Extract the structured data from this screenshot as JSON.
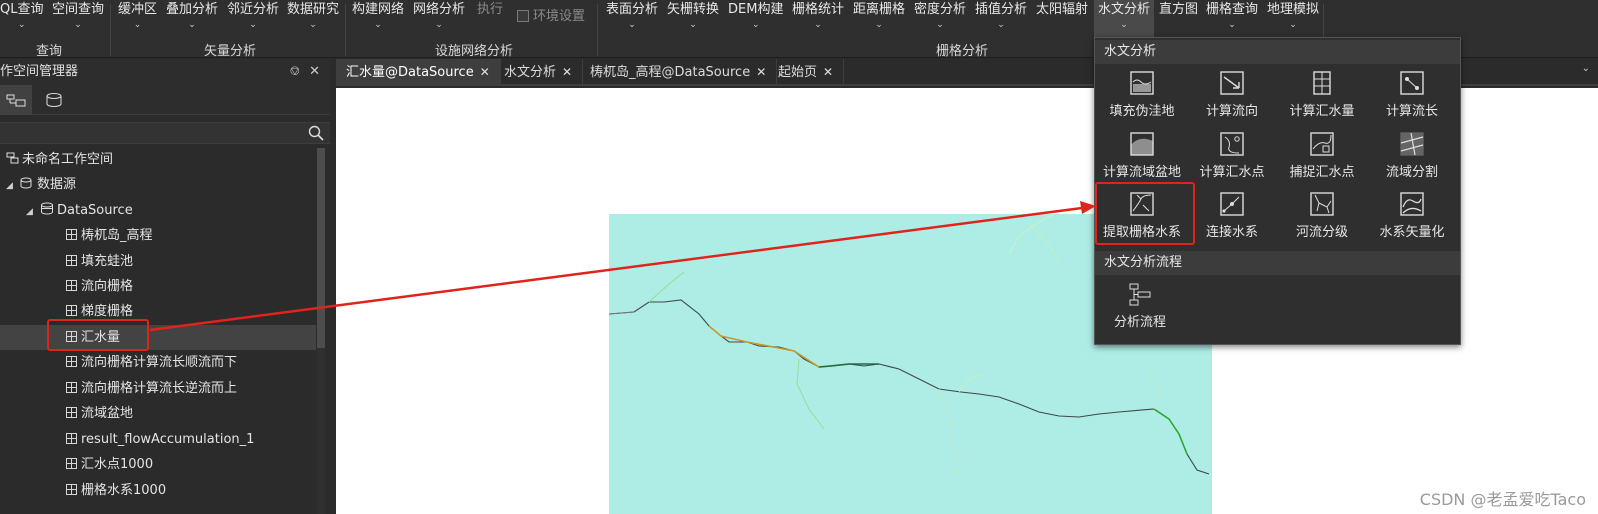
{
  "ribbon": {
    "items": [
      {
        "label": "QL查询",
        "chevron": true
      },
      {
        "label": "空间查询",
        "chevron": true
      },
      {
        "label": "缓冲区",
        "chevron": true
      },
      {
        "label": "叠加分析",
        "chevron": true
      },
      {
        "label": "邻近分析",
        "chevron": true
      },
      {
        "label": "数据研究",
        "chevron": true
      },
      {
        "label": "构建网络",
        "chevron": true
      },
      {
        "label": "网络分析",
        "chevron": true
      },
      {
        "label": "执行",
        "chevron": false
      },
      {
        "label": "环境设置",
        "chevron": false
      },
      {
        "label": "表面分析",
        "chevron": true
      },
      {
        "label": "矢栅转换",
        "chevron": true
      },
      {
        "label": "DEM构建",
        "chevron": true
      },
      {
        "label": "栅格统计",
        "chevron": true
      },
      {
        "label": "距离栅格",
        "chevron": true
      },
      {
        "label": "密度分析",
        "chevron": true
      },
      {
        "label": "插值分析",
        "chevron": true
      },
      {
        "label": "太阳辐射",
        "chevron": false
      },
      {
        "label": "水文分析",
        "chevron": true
      },
      {
        "label": "直方图",
        "chevron": false
      },
      {
        "label": "栅格查询",
        "chevron": true
      },
      {
        "label": "地理模拟",
        "chevron": true
      }
    ],
    "groups": [
      "查询",
      "矢量分析",
      "设施网络分析",
      "栅格分析"
    ]
  },
  "left_panel": {
    "title": "作空间管理器",
    "pin_icon": "pin-icon",
    "close_icon": "close-icon",
    "tree": [
      {
        "label": "未命名工作空间",
        "level": 0,
        "expander": "",
        "icon": "workspace-icon"
      },
      {
        "label": "数据源",
        "level": 0,
        "expander": "◢",
        "icon": "datasources-icon"
      },
      {
        "label": "DataSource",
        "level": 1,
        "expander": "◢",
        "icon": "database-icon"
      },
      {
        "label": "梼杌岛_高程",
        "level": 2,
        "expander": "",
        "icon": "grid-icon"
      },
      {
        "label": "填充蛙池",
        "level": 2,
        "expander": "",
        "icon": "grid-icon"
      },
      {
        "label": "流向栅格",
        "level": 2,
        "expander": "",
        "icon": "grid-icon"
      },
      {
        "label": "梯度栅格",
        "level": 2,
        "expander": "",
        "icon": "grid-icon"
      },
      {
        "label": "汇水量",
        "level": 2,
        "expander": "",
        "icon": "grid-icon",
        "selected": true
      },
      {
        "label": "流向栅格计算流长顺流而下",
        "level": 2,
        "expander": "",
        "icon": "grid-icon"
      },
      {
        "label": "流向栅格计算流长逆流而上",
        "level": 2,
        "expander": "",
        "icon": "grid-icon"
      },
      {
        "label": "流域盆地",
        "level": 2,
        "expander": "",
        "icon": "grid-icon"
      },
      {
        "label": "result_flowAccumulation_1",
        "level": 2,
        "expander": "",
        "icon": "grid-icon"
      },
      {
        "label": "汇水点1000",
        "level": 2,
        "expander": "",
        "icon": "grid-icon"
      },
      {
        "label": "栅格水系1000",
        "level": 2,
        "expander": "",
        "icon": "grid-icon"
      }
    ]
  },
  "doc_tabs": [
    {
      "label": "汇水量@DataSource",
      "selected": true
    },
    {
      "label": "水文分析",
      "selected": false
    },
    {
      "label": "梼杌岛_高程@DataSource",
      "selected": false
    },
    {
      "label": "起始页",
      "selected": false
    }
  ],
  "dropdown": {
    "section1_title": "水文分析",
    "tools": [
      {
        "label": "填充伪洼地",
        "icon": "fill-sink-icon"
      },
      {
        "label": "计算流向",
        "icon": "flow-direction-icon"
      },
      {
        "label": "计算汇水量",
        "icon": "flow-accumulation-icon"
      },
      {
        "label": "计算流长",
        "icon": "flow-length-icon"
      },
      {
        "label": "计算流域盆地",
        "icon": "basin-icon"
      },
      {
        "label": "计算汇水点",
        "icon": "pour-point-icon"
      },
      {
        "label": "捕捉汇水点",
        "icon": "snap-pour-point-icon"
      },
      {
        "label": "流域分割",
        "icon": "watershed-icon"
      },
      {
        "label": "提取栅格水系",
        "icon": "extract-stream-icon"
      },
      {
        "label": "连接水系",
        "icon": "link-stream-icon"
      },
      {
        "label": "河流分级",
        "icon": "stream-order-icon"
      },
      {
        "label": "水系矢量化",
        "icon": "stream-vectorize-icon"
      }
    ],
    "section2_title": "水文分析流程",
    "flow_tool": {
      "label": "分析流程",
      "icon": "workflow-icon"
    }
  },
  "watermark": "CSDN @老孟爱吃Taco",
  "colors": {
    "highlight": "#e0231b",
    "raster": "#aeede6",
    "panel_bg": "#2b2b2b"
  }
}
